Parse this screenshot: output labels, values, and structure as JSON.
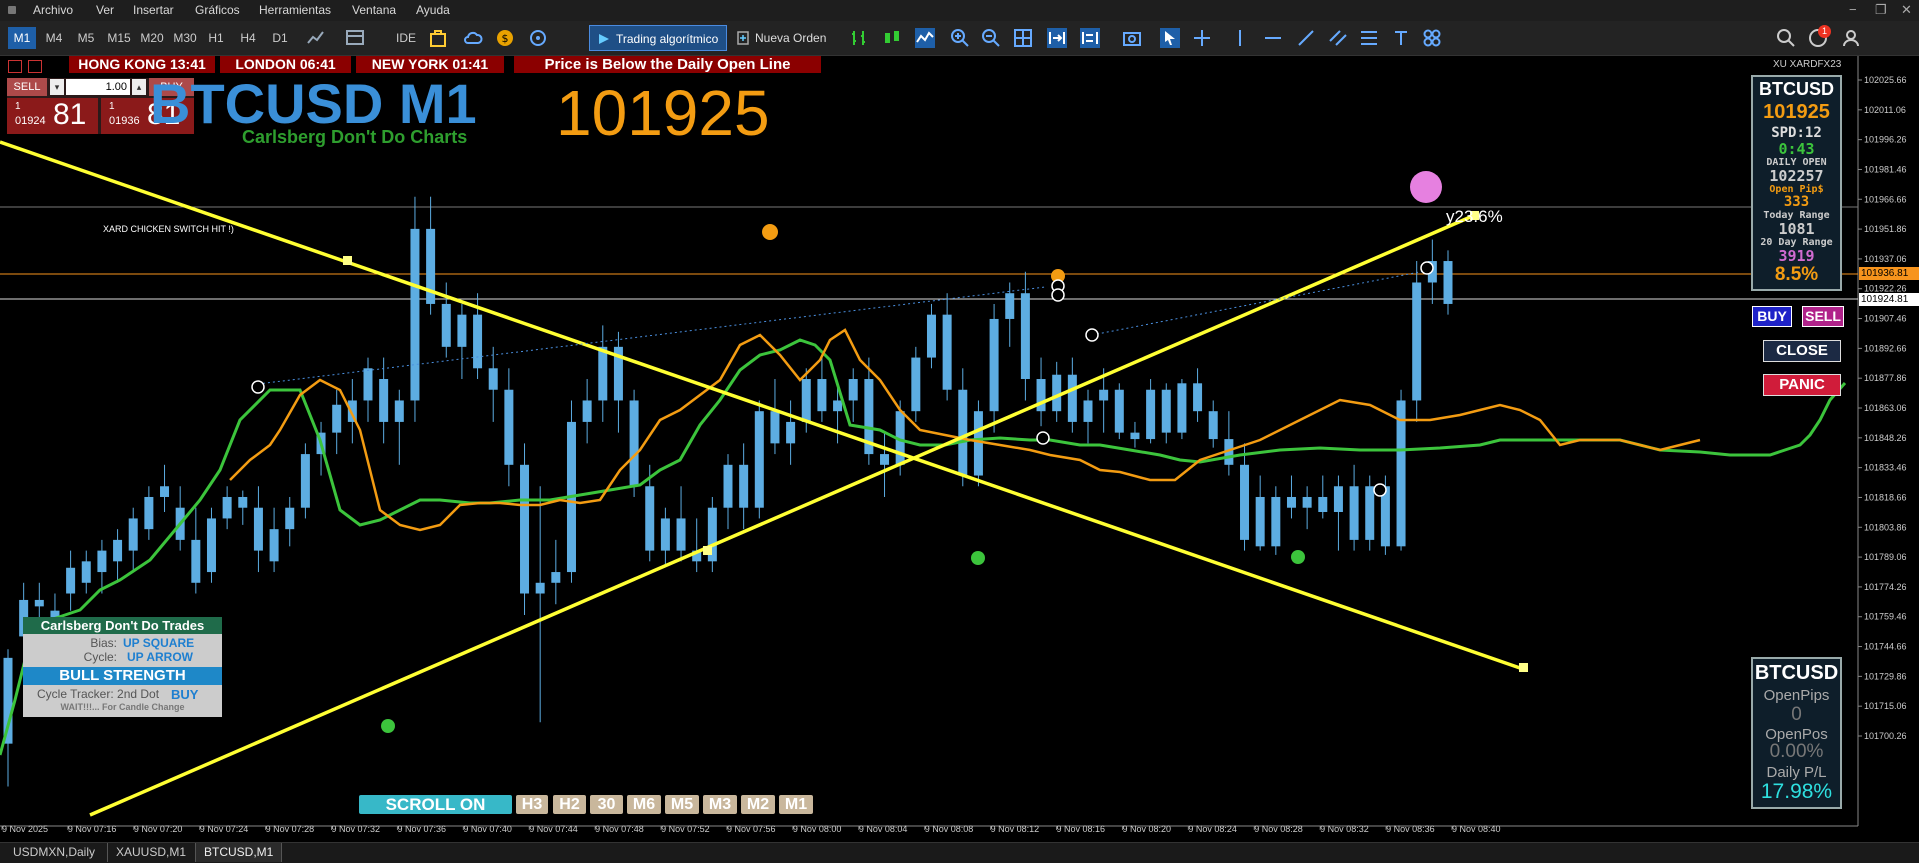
{
  "menu": [
    "Archivo",
    "Ver",
    "Insertar",
    "Gráficos",
    "Herramientas",
    "Ventana",
    "Ayuda"
  ],
  "window_controls": [
    "−",
    "❐",
    "✕"
  ],
  "timeframes": [
    "M1",
    "M4",
    "M5",
    "M15",
    "M20",
    "M30",
    "H1",
    "H4",
    "D1"
  ],
  "active_timeframe": "M1",
  "toolbar": {
    "ide_label": "IDE",
    "algo_label": "Trading algorítmico",
    "new_order_label": "Nueva Orden",
    "notifications_count": "1"
  },
  "clocks": [
    {
      "city": "HONG KONG",
      "time": "13:41"
    },
    {
      "city": "LONDON",
      "time": "06:41"
    },
    {
      "city": "NEW YORK",
      "time": "01:41"
    }
  ],
  "alert_text": "Price is Below the Daily Open Line",
  "one_click": {
    "sell_label": "SELL",
    "buy_label": "BUY",
    "volume": "1.00",
    "sell_price_small": "1",
    "sell_price_mid": "01924",
    "sell_price_big": "81",
    "buy_price_small": "1",
    "buy_price_mid": "01936",
    "buy_price_big": "81"
  },
  "chart_title": "BTCUSD M1",
  "chart_subtitle": "Carlsberg Don't Do Charts",
  "big_price": "101925",
  "top_right_label": "XU XARDFX23",
  "chart_annotation": "XARD CHICKEN SWITCH HIT !)",
  "line_label": "y23.6%",
  "price_axis": [
    "102025.66",
    "102011.06",
    "101996.26",
    "101981.46",
    "101966.66",
    "101951.86",
    "101937.06",
    "101922.26",
    "101907.46",
    "101892.66",
    "101877.86",
    "101863.06",
    "101848.26",
    "101833.46",
    "101818.66",
    "101803.86",
    "101789.06",
    "101774.26",
    "101759.46",
    "101744.66",
    "101729.86",
    "101715.06",
    "101700.26"
  ],
  "price_tags": [
    {
      "value": "101936.81",
      "color": "#f7941d",
      "text_color": "#000000"
    },
    {
      "value": "101924.81",
      "color": "#ffffff",
      "text_color": "#000000"
    }
  ],
  "time_axis": [
    "9 Nov 2025",
    "9 Nov 07:16",
    "9 Nov 07:20",
    "9 Nov 07:24",
    "9 Nov 07:28",
    "9 Nov 07:32",
    "9 Nov 07:36",
    "9 Nov 07:40",
    "9 Nov 07:44",
    "9 Nov 07:48",
    "9 Nov 07:52",
    "9 Nov 07:56",
    "9 Nov 08:00",
    "9 Nov 08:04",
    "9 Nov 08:08",
    "9 Nov 08:12",
    "9 Nov 08:16",
    "9 Nov 08:20",
    "9 Nov 08:24",
    "9 Nov 08:28",
    "9 Nov 08:32",
    "9 Nov 08:36",
    "9 Nov 08:40"
  ],
  "info_panel": {
    "symbol": "BTCUSD",
    "price": "101925",
    "spread": "SPD:12",
    "timer": "0:43",
    "daily_open_label": "DAILY OPEN",
    "daily_open": "102257",
    "open_pips_label": "Open Pip$",
    "open_pips": "333",
    "today_range_label": "Today Range",
    "today_range": "1081",
    "day20_range_label": "20 Day Range",
    "day20_range": "3919",
    "range_pct": "8.5%"
  },
  "trade_buttons": {
    "buy": "BUY",
    "sell": "SELL",
    "close": "CLOSE",
    "panic": "PANIC"
  },
  "pnl_panel": {
    "symbol": "BTCUSD",
    "open_pips_label": "OpenPips",
    "open_pips": "0",
    "open_pos_label": "OpenPos",
    "open_pos": "0.00%",
    "daily_pl_label": "Daily P/L",
    "daily_pl": "17.98%"
  },
  "trades_panel": {
    "title": "Carlsberg Don't Do Trades",
    "bias_label": "Bias:",
    "bias_value": "UP SQUARE",
    "cycle_label": "Cycle:",
    "cycle_value": "UP ARROW",
    "strength": "BULL STRENGTH",
    "tracker_label": "Cycle Tracker: 2nd Dot",
    "tracker_value": "BUY",
    "wait_text": "WAIT!!!... For Candle Change"
  },
  "scroll_label": "SCROLL ON",
  "tf_buttons": [
    "H3",
    "H2",
    "30",
    "M6",
    "M5",
    "M3",
    "M2",
    "M1"
  ],
  "bottom_tabs": [
    "USDMXN,Daily",
    "XAUUSD,M1",
    "BTCUSD,M1"
  ],
  "active_tab": "BTCUSD,M1",
  "colors": {
    "candle": "#5dade2",
    "ema_fast": "#f39c12",
    "ema_slow": "#3cc43c",
    "trendline": "#ffff33",
    "alert_bg": "#8b0000",
    "price_orange": "#f7941d"
  },
  "chart_data": {
    "type": "candlestick",
    "y_range": [
      101690,
      102035
    ],
    "candles": [
      {
        "o": 101760,
        "h": 101764,
        "l": 101700,
        "c": 101720
      },
      {
        "o": 101770,
        "h": 101795,
        "l": 101755,
        "c": 101787
      },
      {
        "o": 101787,
        "h": 101795,
        "l": 101778,
        "c": 101784
      },
      {
        "o": 101775,
        "h": 101790,
        "l": 101765,
        "c": 101782
      },
      {
        "o": 101790,
        "h": 101810,
        "l": 101782,
        "c": 101802
      },
      {
        "o": 101795,
        "h": 101810,
        "l": 101790,
        "c": 101805
      },
      {
        "o": 101800,
        "h": 101815,
        "l": 101790,
        "c": 101810
      },
      {
        "o": 101805,
        "h": 101820,
        "l": 101795,
        "c": 101815
      },
      {
        "o": 101810,
        "h": 101830,
        "l": 101800,
        "c": 101825
      },
      {
        "o": 101820,
        "h": 101840,
        "l": 101815,
        "c": 101835
      },
      {
        "o": 101835,
        "h": 101850,
        "l": 101828,
        "c": 101840
      },
      {
        "o": 101830,
        "h": 101840,
        "l": 101810,
        "c": 101815
      },
      {
        "o": 101815,
        "h": 101830,
        "l": 101790,
        "c": 101795
      },
      {
        "o": 101800,
        "h": 101830,
        "l": 101795,
        "c": 101825
      },
      {
        "o": 101825,
        "h": 101840,
        "l": 101820,
        "c": 101835
      },
      {
        "o": 101835,
        "h": 101838,
        "l": 101822,
        "c": 101830
      },
      {
        "o": 101830,
        "h": 101840,
        "l": 101800,
        "c": 101810
      },
      {
        "o": 101805,
        "h": 101830,
        "l": 101800,
        "c": 101820
      },
      {
        "o": 101820,
        "h": 101835,
        "l": 101812,
        "c": 101830
      },
      {
        "o": 101830,
        "h": 101860,
        "l": 101825,
        "c": 101855
      },
      {
        "o": 101855,
        "h": 101870,
        "l": 101845,
        "c": 101865
      },
      {
        "o": 101865,
        "h": 101885,
        "l": 101855,
        "c": 101878
      },
      {
        "o": 101870,
        "h": 101890,
        "l": 101860,
        "c": 101880
      },
      {
        "o": 101880,
        "h": 101900,
        "l": 101870,
        "c": 101895
      },
      {
        "o": 101890,
        "h": 101900,
        "l": 101860,
        "c": 101870
      },
      {
        "o": 101870,
        "h": 101885,
        "l": 101850,
        "c": 101880
      },
      {
        "o": 101880,
        "h": 101975,
        "l": 101870,
        "c": 101960
      },
      {
        "o": 101960,
        "h": 101975,
        "l": 101920,
        "c": 101925
      },
      {
        "o": 101925,
        "h": 101935,
        "l": 101900,
        "c": 101905
      },
      {
        "o": 101905,
        "h": 101925,
        "l": 101890,
        "c": 101920
      },
      {
        "o": 101920,
        "h": 101930,
        "l": 101890,
        "c": 101895
      },
      {
        "o": 101895,
        "h": 101905,
        "l": 101870,
        "c": 101885
      },
      {
        "o": 101885,
        "h": 101895,
        "l": 101840,
        "c": 101850
      },
      {
        "o": 101850,
        "h": 101860,
        "l": 101780,
        "c": 101790
      },
      {
        "o": 101790,
        "h": 101840,
        "l": 101730,
        "c": 101795
      },
      {
        "o": 101795,
        "h": 101815,
        "l": 101785,
        "c": 101800
      },
      {
        "o": 101800,
        "h": 101880,
        "l": 101795,
        "c": 101870
      },
      {
        "o": 101870,
        "h": 101890,
        "l": 101860,
        "c": 101880
      },
      {
        "o": 101880,
        "h": 101915,
        "l": 101870,
        "c": 101905
      },
      {
        "o": 101905,
        "h": 101912,
        "l": 101865,
        "c": 101880
      },
      {
        "o": 101880,
        "h": 101885,
        "l": 101835,
        "c": 101840
      },
      {
        "o": 101840,
        "h": 101850,
        "l": 101805,
        "c": 101810
      },
      {
        "o": 101810,
        "h": 101830,
        "l": 101803,
        "c": 101825
      },
      {
        "o": 101825,
        "h": 101840,
        "l": 101805,
        "c": 101810
      },
      {
        "o": 101810,
        "h": 101825,
        "l": 101800,
        "c": 101805
      },
      {
        "o": 101805,
        "h": 101835,
        "l": 101800,
        "c": 101830
      },
      {
        "o": 101830,
        "h": 101855,
        "l": 101820,
        "c": 101850
      },
      {
        "o": 101850,
        "h": 101860,
        "l": 101820,
        "c": 101830
      },
      {
        "o": 101830,
        "h": 101880,
        "l": 101825,
        "c": 101875
      },
      {
        "o": 101875,
        "h": 101890,
        "l": 101855,
        "c": 101860
      },
      {
        "o": 101860,
        "h": 101880,
        "l": 101850,
        "c": 101870
      },
      {
        "o": 101870,
        "h": 101895,
        "l": 101865,
        "c": 101890
      },
      {
        "o": 101890,
        "h": 101900,
        "l": 101870,
        "c": 101875
      },
      {
        "o": 101875,
        "h": 101888,
        "l": 101860,
        "c": 101880
      },
      {
        "o": 101880,
        "h": 101895,
        "l": 101870,
        "c": 101890
      },
      {
        "o": 101890,
        "h": 101900,
        "l": 101850,
        "c": 101855
      },
      {
        "o": 101855,
        "h": 101865,
        "l": 101835,
        "c": 101850
      },
      {
        "o": 101850,
        "h": 101880,
        "l": 101845,
        "c": 101875
      },
      {
        "o": 101875,
        "h": 101905,
        "l": 101870,
        "c": 101900
      },
      {
        "o": 101900,
        "h": 101925,
        "l": 101895,
        "c": 101920
      },
      {
        "o": 101920,
        "h": 101930,
        "l": 101880,
        "c": 101885
      },
      {
        "o": 101885,
        "h": 101895,
        "l": 101840,
        "c": 101845
      },
      {
        "o": 101845,
        "h": 101880,
        "l": 101840,
        "c": 101875
      },
      {
        "o": 101875,
        "h": 101925,
        "l": 101865,
        "c": 101918
      },
      {
        "o": 101918,
        "h": 101935,
        "l": 101905,
        "c": 101930
      },
      {
        "o": 101930,
        "h": 101940,
        "l": 101880,
        "c": 101890
      },
      {
        "o": 101890,
        "h": 101900,
        "l": 101868,
        "c": 101875
      },
      {
        "o": 101875,
        "h": 101898,
        "l": 101870,
        "c": 101892
      },
      {
        "o": 101892,
        "h": 101900,
        "l": 101865,
        "c": 101870
      },
      {
        "o": 101870,
        "h": 101885,
        "l": 101860,
        "c": 101880
      },
      {
        "o": 101880,
        "h": 101895,
        "l": 101865,
        "c": 101885
      },
      {
        "o": 101885,
        "h": 101888,
        "l": 101862,
        "c": 101865
      },
      {
        "o": 101865,
        "h": 101870,
        "l": 101858,
        "c": 101862
      },
      {
        "o": 101862,
        "h": 101890,
        "l": 101860,
        "c": 101885
      },
      {
        "o": 101885,
        "h": 101888,
        "l": 101860,
        "c": 101865
      },
      {
        "o": 101865,
        "h": 101890,
        "l": 101862,
        "c": 101888
      },
      {
        "o": 101888,
        "h": 101895,
        "l": 101870,
        "c": 101875
      },
      {
        "o": 101875,
        "h": 101880,
        "l": 101858,
        "c": 101862
      },
      {
        "o": 101862,
        "h": 101875,
        "l": 101845,
        "c": 101850
      },
      {
        "o": 101850,
        "h": 101860,
        "l": 101810,
        "c": 101815
      },
      {
        "o": 101835,
        "h": 101845,
        "l": 101810,
        "c": 101812
      },
      {
        "o": 101812,
        "h": 101840,
        "l": 101808,
        "c": 101835
      },
      {
        "o": 101835,
        "h": 101845,
        "l": 101825,
        "c": 101830
      },
      {
        "o": 101830,
        "h": 101840,
        "l": 101820,
        "c": 101835
      },
      {
        "o": 101835,
        "h": 101845,
        "l": 101825,
        "c": 101828
      },
      {
        "o": 101828,
        "h": 101845,
        "l": 101810,
        "c": 101840
      },
      {
        "o": 101840,
        "h": 101850,
        "l": 101810,
        "c": 101815
      },
      {
        "o": 101815,
        "h": 101845,
        "l": 101810,
        "c": 101840
      },
      {
        "o": 101840,
        "h": 101845,
        "l": 101808,
        "c": 101812
      },
      {
        "o": 101812,
        "h": 101885,
        "l": 101810,
        "c": 101880
      },
      {
        "o": 101880,
        "h": 101945,
        "l": 101870,
        "c": 101935
      },
      {
        "o": 101935,
        "h": 101955,
        "l": 101925,
        "c": 101945
      },
      {
        "o": 101945,
        "h": 101950,
        "l": 101920,
        "c": 101925
      }
    ]
  }
}
